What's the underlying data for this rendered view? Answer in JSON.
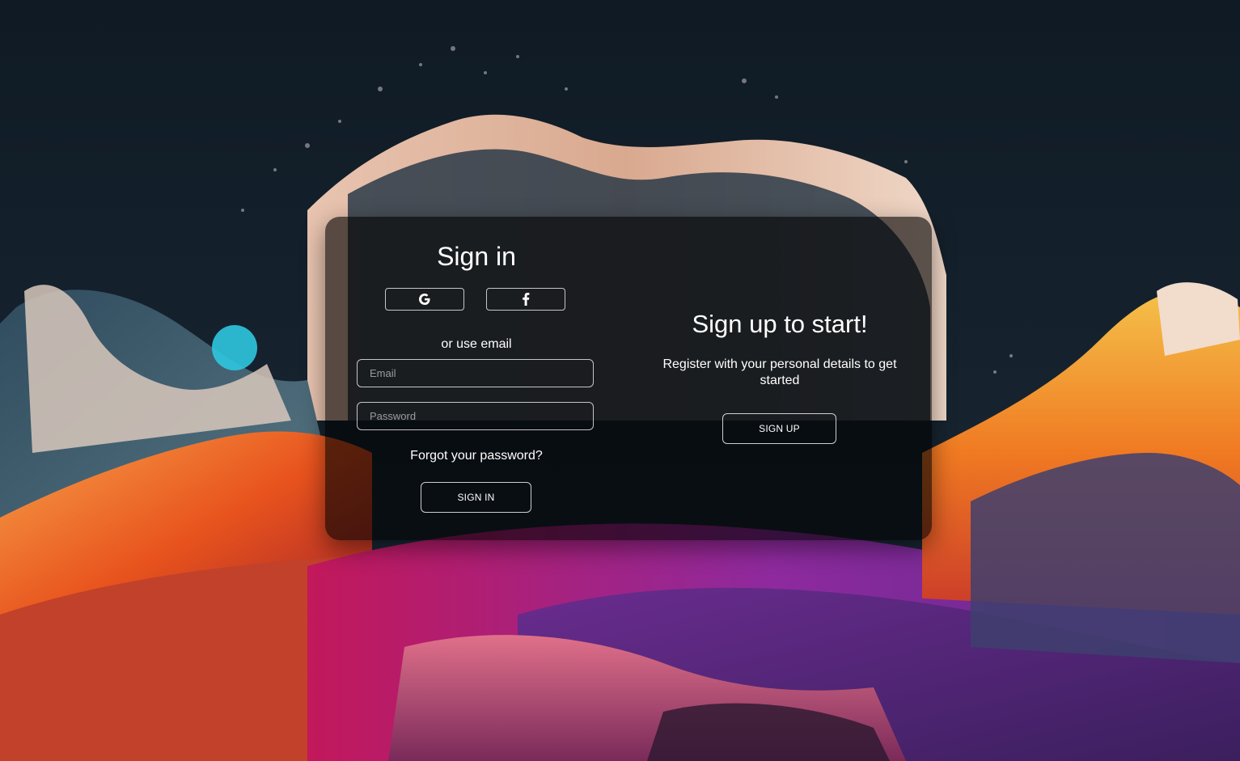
{
  "signin": {
    "title": "Sign in",
    "social": [
      {
        "name": "google",
        "icon": "google-icon"
      },
      {
        "name": "facebook",
        "icon": "facebook-icon"
      }
    ],
    "divider_text": "or use email",
    "email": {
      "placeholder": "Email",
      "value": ""
    },
    "password": {
      "placeholder": "Password",
      "value": ""
    },
    "forgot_label": "Forgot your password?",
    "button_label": "SIGN IN"
  },
  "signup": {
    "title": "Sign up to start!",
    "description": "Register with your personal details to get started",
    "button_label": "SIGN UP"
  },
  "colors": {
    "card_background": "rgba(0,0,0,0.62)",
    "text": "#ffffff",
    "border": "#ffffff"
  }
}
